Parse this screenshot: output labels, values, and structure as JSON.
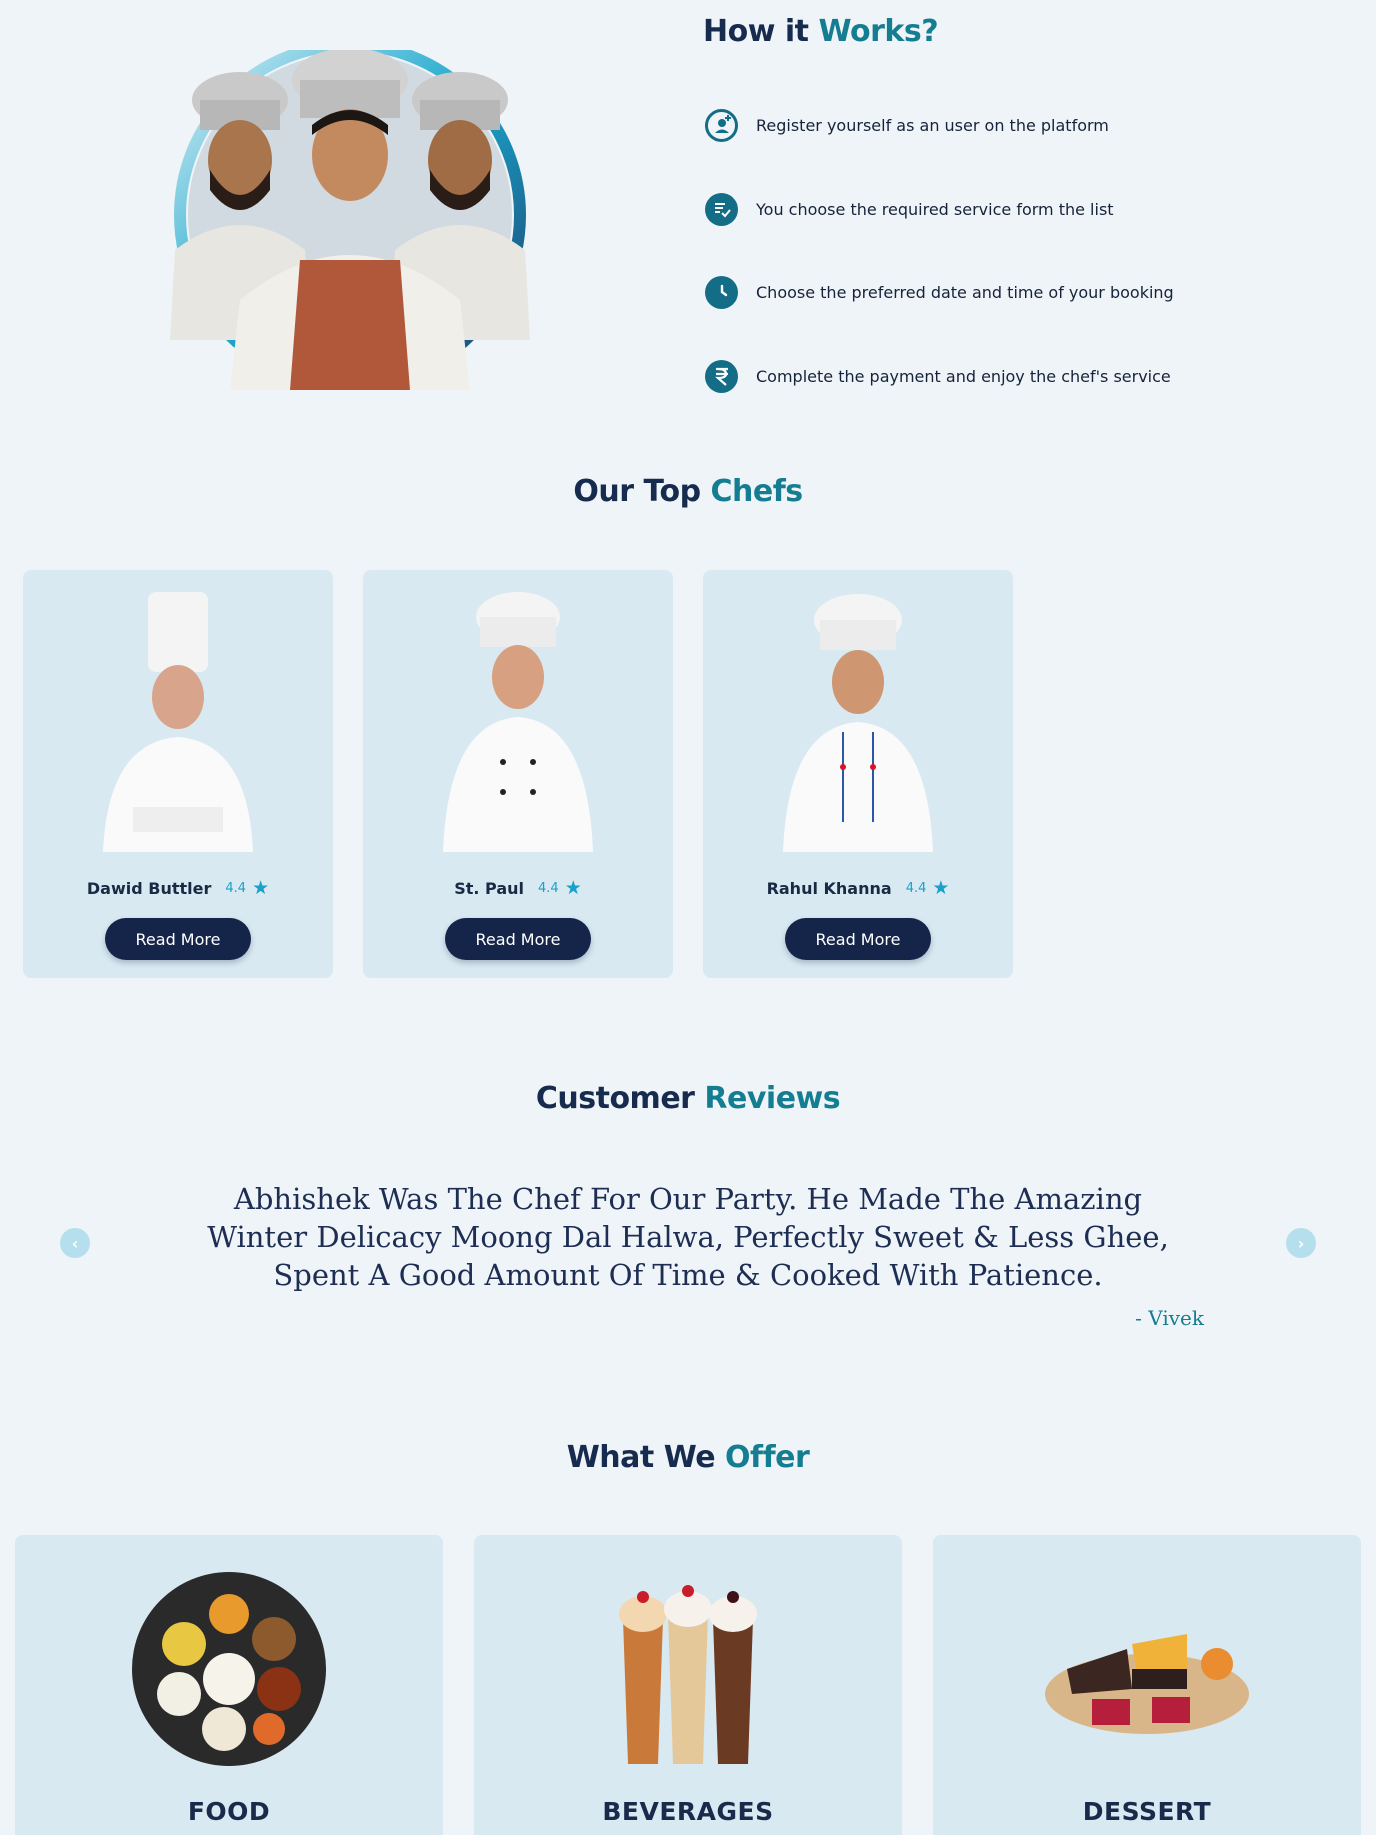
{
  "how_it_works": {
    "title_main": "How it ",
    "title_accent": "Works?",
    "steps": [
      {
        "icon": "user-add-icon",
        "text": "Register yourself as an user on the platform"
      },
      {
        "icon": "checklist-icon",
        "text": "You choose the required service form the list"
      },
      {
        "icon": "clock-icon",
        "text": "Choose the preferred date and time of your booking"
      },
      {
        "icon": "rupee-icon",
        "text": "Complete the payment and enjoy the chef's service"
      }
    ]
  },
  "top_chefs": {
    "title_main": "Our Top ",
    "title_accent": "Chefs",
    "chefs": [
      {
        "name": "Dawid Buttler",
        "rating": "4.4",
        "button": "Read More"
      },
      {
        "name": "St. Paul",
        "rating": "4.4",
        "button": "Read More"
      },
      {
        "name": "Rahul Khanna",
        "rating": "4.4",
        "button": "Read More"
      }
    ]
  },
  "reviews": {
    "title_main": "Customer ",
    "title_accent": "Reviews",
    "text": "Abhishek Was The Chef For Our Party. He Made The Amazing Winter Delicacy Moong Dal Halwa, Perfectly Sweet & Less Ghee, Spent A Good Amount Of Time & Cooked With Patience.",
    "author": "- Vivek"
  },
  "offer": {
    "title_main": "What We ",
    "title_accent": "Offer",
    "items": [
      {
        "label": "FOOD"
      },
      {
        "label": "BEVERAGES"
      },
      {
        "label": "DESSERT"
      }
    ]
  },
  "colors": {
    "navy": "#172b4f",
    "accent": "#147d91",
    "card_bg": "#d9e9f2",
    "page_bg": "#eef4f7",
    "star": "#1aa1c9"
  }
}
